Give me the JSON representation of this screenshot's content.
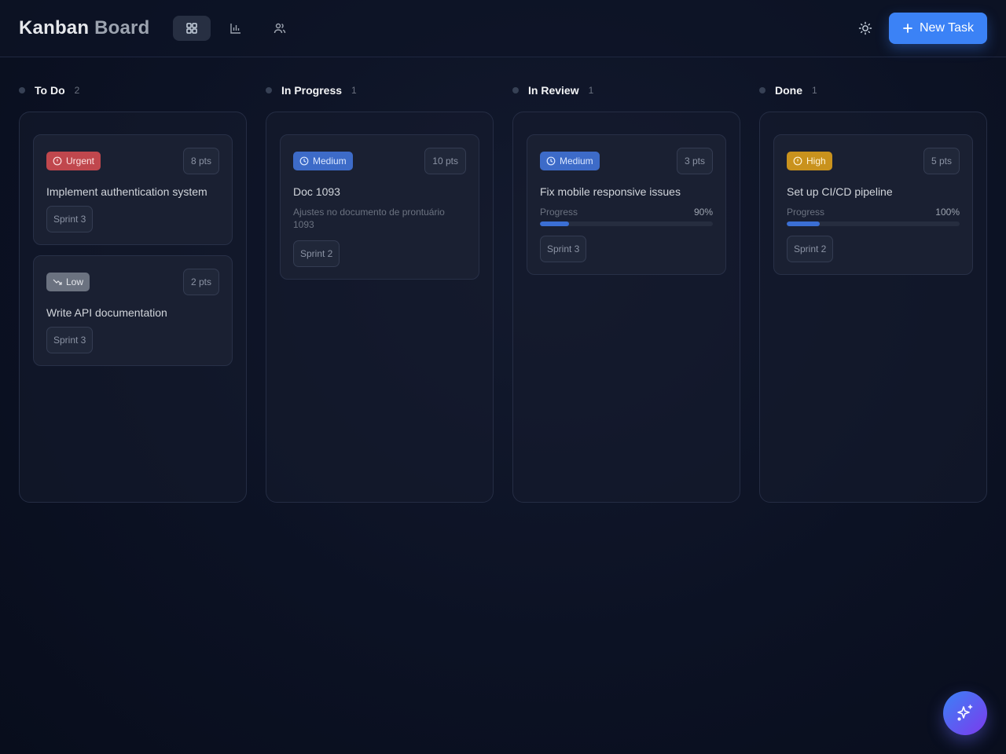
{
  "header": {
    "brand_part1": "Kanban",
    "brand_part2": "Board",
    "nav": [
      {
        "icon": "grid-icon",
        "active": true
      },
      {
        "icon": "bar-chart-icon",
        "active": false
      },
      {
        "icon": "users-icon",
        "active": false
      }
    ],
    "theme_icon": "sun-icon",
    "new_task_label": "New Task"
  },
  "columns": [
    {
      "title": "To Do",
      "count": "2",
      "cards": [
        {
          "priority": "Urgent",
          "priority_icon": "alert-circle-icon",
          "points": "8 pts",
          "title": "Implement authentication system",
          "sprint": "Sprint 3"
        },
        {
          "priority": "Low",
          "priority_icon": "trending-down-icon",
          "points": "2 pts",
          "title": "Write API documentation",
          "sprint": "Sprint 3"
        }
      ]
    },
    {
      "title": "In Progress",
      "count": "1",
      "cards": [
        {
          "priority": "Medium",
          "priority_icon": "clock-icon",
          "points": "10 pts",
          "title": "Doc 1093",
          "description": "Ajustes no documento de prontuário 1093",
          "sprint": "Sprint 2"
        }
      ]
    },
    {
      "title": "In Review",
      "count": "1",
      "cards": [
        {
          "priority": "Medium",
          "priority_icon": "clock-icon",
          "points": "3 pts",
          "title": "Fix mobile responsive issues",
          "progress_label": "Progress",
          "progress_text": "90%",
          "progress_fraction": 0.17,
          "sprint": "Sprint 3"
        }
      ]
    },
    {
      "title": "Done",
      "count": "1",
      "cards": [
        {
          "priority": "High",
          "priority_icon": "alert-circle-icon",
          "points": "5 pts",
          "title": "Set up CI/CD pipeline",
          "progress_label": "Progress",
          "progress_text": "100%",
          "progress_fraction": 0.19,
          "sprint": "Sprint 2"
        }
      ]
    }
  ],
  "fab_icon": "sparkles-icon",
  "colors": {
    "accent": "#3b82f6",
    "urgent": "#c0474d",
    "medium": "#3d6bc8",
    "low": "#6b7280",
    "high": "#c9921d"
  }
}
